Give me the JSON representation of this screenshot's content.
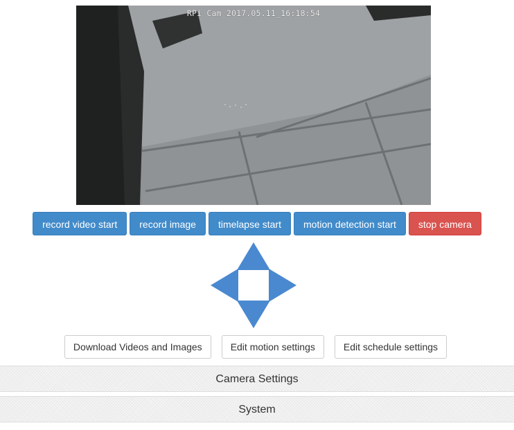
{
  "preview": {
    "overlay_text": "RPi Cam 2017.05.11_16:18:54"
  },
  "actions": {
    "record_video": "record video start",
    "record_image": "record image",
    "timelapse": "timelapse start",
    "motion_detection": "motion detection start",
    "stop_camera": "stop camera"
  },
  "ptz": {
    "icons": [
      "arrow-up-icon",
      "arrow-left-icon",
      "arrow-right-icon",
      "arrow-down-icon"
    ],
    "color": "#4a89d0"
  },
  "links": {
    "download": "Download Videos and Images",
    "motion_settings": "Edit motion settings",
    "schedule_settings": "Edit schedule settings"
  },
  "panels": {
    "camera_settings": "Camera Settings",
    "system": "System"
  },
  "colors": {
    "primary": "#428bca",
    "danger": "#d9534f",
    "panel_bg": "#f5f5f5"
  }
}
